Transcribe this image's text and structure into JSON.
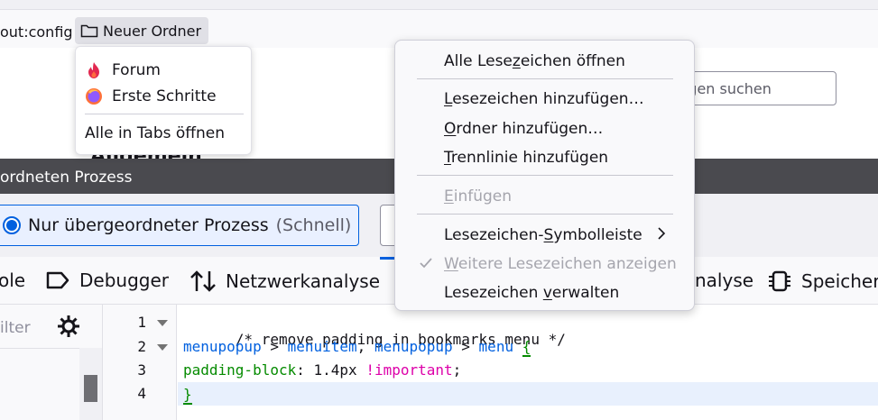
{
  "bookmarks_bar": {
    "about_config": "out:config",
    "folder_label": "Neuer Ordner"
  },
  "folder_popup": {
    "items": [
      {
        "label": "Forum",
        "icon": "flame-icon"
      },
      {
        "label": "Erste Schritte",
        "icon": "firefox-icon"
      }
    ],
    "open_all": "Alle in Tabs öffnen"
  },
  "page": {
    "search_placeholder": "ungen suchen"
  },
  "devtools": {
    "title": "ordneten Prozess",
    "process_option": "Nur übergeordneter Prozess",
    "process_hint": "(Schnell)",
    "tabs": {
      "console_fragment": "ole",
      "debugger": "Debugger",
      "network": "Netzwerkanalyse",
      "perf_fragment": "nalyse",
      "memory": "Speicher"
    },
    "filter_placeholder": "ilter",
    "line_numbers": [
      "1",
      "2",
      "3",
      "4"
    ],
    "code": {
      "line1": "/* remove padding in bookmarks menu */",
      "line2_sel1": "menupopup",
      "line2_op1": " > ",
      "line2_sel2": "menuitem",
      "line2_comma": ", ",
      "line2_sel3": "menupopup",
      "line2_op2": " > ",
      "line2_sel4": "menu",
      "line2_space": " ",
      "line2_brace": "{",
      "line3_prop": "padding-block",
      "line3_colon": ": ",
      "line3_val": "1.4px",
      "line3_space": " ",
      "line3_imp": "!important",
      "line3_semi": ";",
      "line4": "}"
    }
  },
  "context_menu": {
    "open_all_pre": "Alle Lese",
    "open_all_u": "z",
    "open_all_post": "eichen öffnen",
    "add_bm_u": "L",
    "add_bm_post": "esezeichen hinzufügen…",
    "add_folder_u": "O",
    "add_folder_post": "rdner hinzufügen…",
    "add_sep_u": "T",
    "add_sep_post": "rennlinie hinzufügen",
    "paste_u": "E",
    "paste_post": "infügen",
    "toolbar_pre": "Lesezeichen-",
    "toolbar_u": "S",
    "toolbar_post": "ymbolleiste",
    "more_u": "W",
    "more_post": "eitere Lesezeichen anzeigen",
    "manage_pre": "Lesezeichen ",
    "manage_u": "v",
    "manage_post": "erwalten"
  },
  "colors": {
    "accent": "#0060df",
    "titlebar": "#4a4a4f",
    "selector": "#0060df",
    "property": "#058b00",
    "important": "#dd00a9"
  }
}
